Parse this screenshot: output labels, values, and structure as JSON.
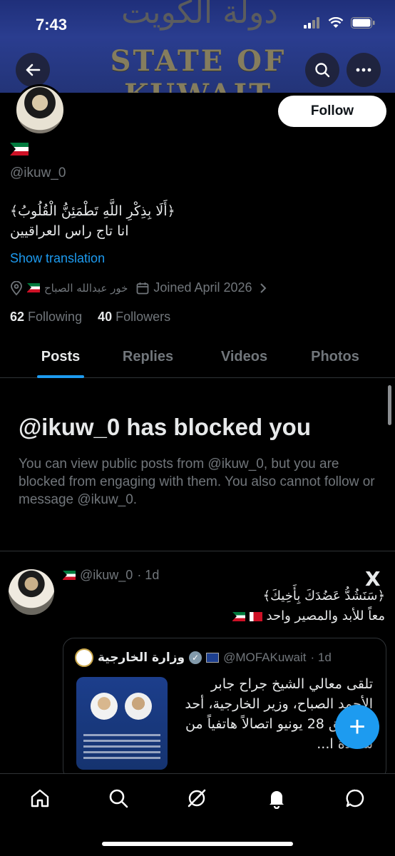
{
  "status_bar": {
    "time": "7:43"
  },
  "banner": {
    "title": "STATE OF KUWAIT",
    "arabic": "دولة الكويت"
  },
  "profile": {
    "follow_label": "Follow",
    "handle": "@ikuw_0",
    "bio_line1": "﴿أَلَا بِذِكْرِ اللَّهِ تَطْمَئِنُّ الْقُلُوبُ﴾",
    "bio_line2": "انا تاج راس العراقيين",
    "show_translation": "Show translation",
    "location": "خور عبدالله الصباح",
    "joined": "Joined April 2026",
    "following_count": "62",
    "following_label": "Following",
    "followers_count": "40",
    "followers_label": "Followers"
  },
  "tabs": [
    "Posts",
    "Replies",
    "Videos",
    "Photos"
  ],
  "blocked": {
    "title": "@ikuw_0 has blocked you",
    "description": "You can view public posts from @ikuw_0, but you are blocked from engaging with them. You also cannot follow or message @ikuw_0."
  },
  "tweet": {
    "handle": "@ikuw_0",
    "time": "· 1d",
    "logo": "X",
    "line1": "﴿سَنَشُدُّ عَضُدَكَ بِأَخِيكَ﴾",
    "line2": "معاً للأبد والمصير واحد",
    "quote": {
      "name": "وزارة الخارجية",
      "handle": "@MOFAKuwait",
      "time": "· 1d",
      "text": "تلقى معالي الشيخ جراح جابر الأحمد الصباح، وزير الخارجية، أحد الموافق 28 يونيو اتصالاً هاتفياً من سعادة ا..."
    }
  },
  "fab_label": "+",
  "icons": {
    "back": "back-arrow-icon",
    "search": "search-icon",
    "more": "more-icon",
    "location": "location-pin-icon",
    "calendar": "calendar-icon",
    "home": "home-icon",
    "explore": "search-icon",
    "grok": "grok-icon",
    "notifications": "bell-icon",
    "messages": "message-icon"
  },
  "colors": {
    "accent": "#1d9bf0",
    "background": "#000000",
    "muted": "#71767b"
  }
}
